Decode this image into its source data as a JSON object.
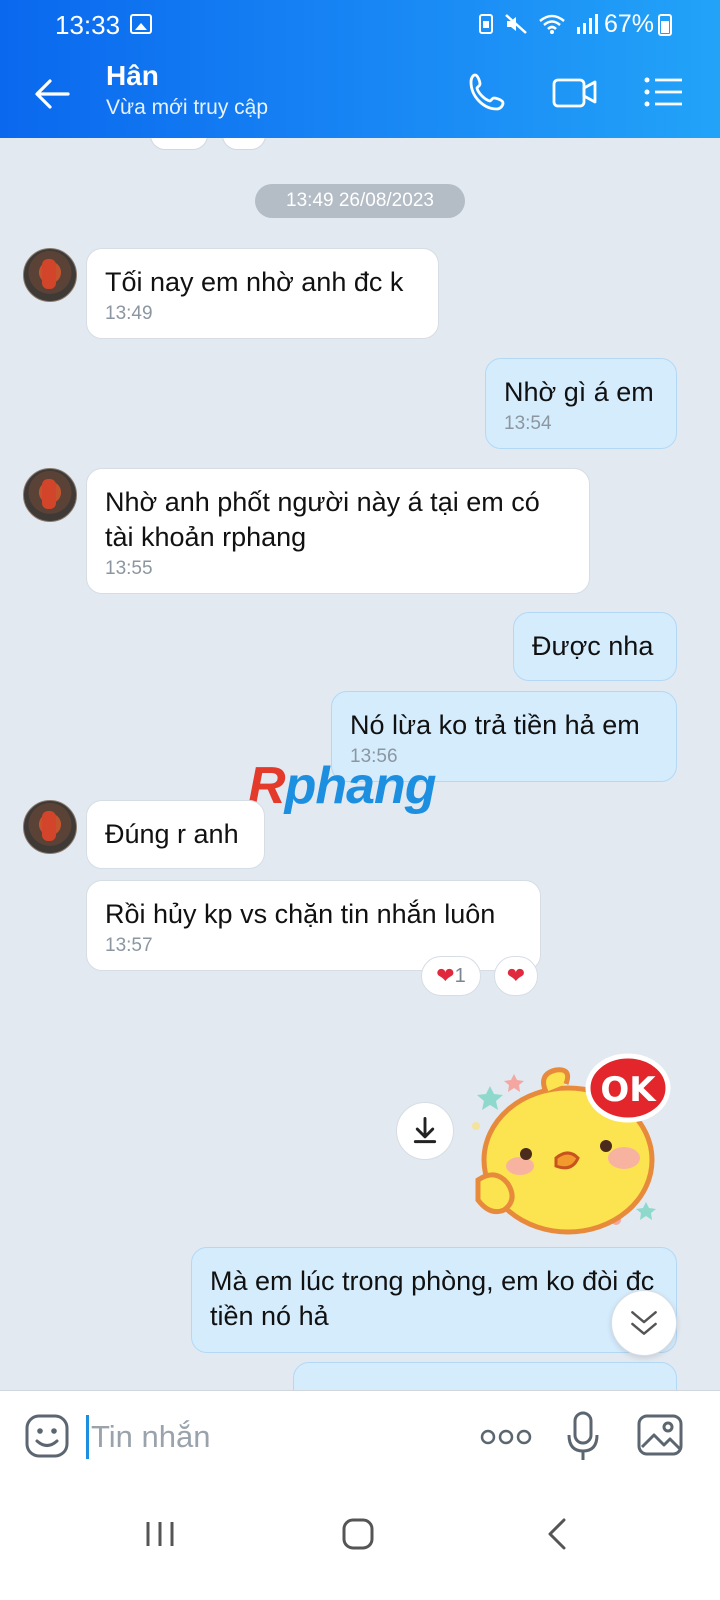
{
  "status_bar": {
    "time": "13:33",
    "battery": "67%"
  },
  "header": {
    "contact_name": "Hân",
    "contact_status": "Vừa mới truy cập"
  },
  "chat": {
    "date_separator": "13:49 26/08/2023",
    "messages": [
      {
        "side": "in",
        "text": "Tối nay em nhờ anh đc k",
        "time": "13:49"
      },
      {
        "side": "out",
        "text": "Nhờ gì á em",
        "time": "13:54"
      },
      {
        "side": "in",
        "text": "Nhờ anh phốt người này á tại em có tài khoản rphang",
        "time": "13:55"
      },
      {
        "side": "out",
        "text": "Được nha",
        "time": ""
      },
      {
        "side": "out",
        "text": "Nó lừa ko trả tiền hả em",
        "time": "13:56"
      },
      {
        "side": "in",
        "text": "Đúng r anh",
        "time": ""
      },
      {
        "side": "in",
        "text": "Rồi hủy kp vs chặn tin nhắn luôn",
        "time": "13:57"
      },
      {
        "side": "out",
        "text": "Mà em lúc trong phòng, em ko đòi đc tiền nó hả",
        "time": ""
      }
    ],
    "reaction_count": "1",
    "watermark": {
      "part1": "R",
      "part2": "phang"
    },
    "sticker_text": "OK"
  },
  "input": {
    "placeholder": "Tin nhắn"
  },
  "colors": {
    "header_start": "#0a68ee",
    "header_end": "#22a3f8",
    "outgoing_bubble": "#d5ecfd",
    "incoming_bubble": "#ffffff",
    "heart": "#e0293d"
  }
}
